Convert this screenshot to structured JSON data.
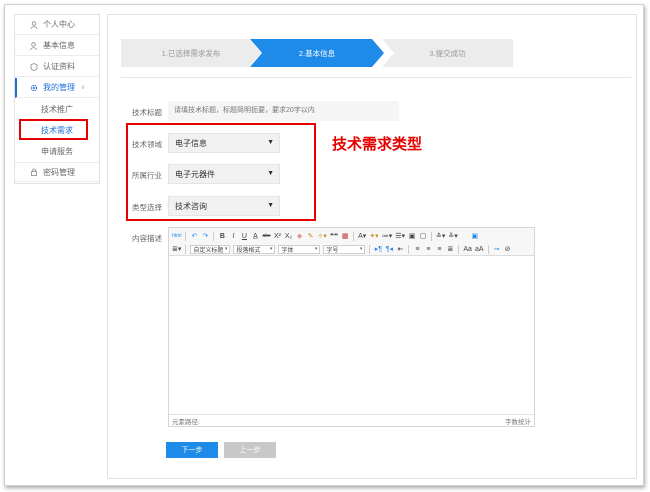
{
  "sidebar": {
    "items": [
      {
        "label": "个人中心",
        "icon": "user-icon"
      },
      {
        "label": "基本信息",
        "icon": "user-info-icon"
      },
      {
        "label": "认证资料",
        "icon": "shield-icon"
      },
      {
        "label": "我的管理",
        "icon": "gear-icon"
      },
      {
        "label": "技术推广"
      },
      {
        "label": "技术需求"
      },
      {
        "label": "申请服务"
      },
      {
        "label": "密码管理",
        "icon": "lock-icon"
      }
    ]
  },
  "steps": [
    {
      "label": "1.已选择需求发布",
      "state": "done"
    },
    {
      "label": "2.基本信息",
      "state": "active"
    },
    {
      "label": "3.提交成功",
      "state": "pending"
    }
  ],
  "form": {
    "title_label": "技术标题",
    "title_placeholder": "请填技术标题，标题简明扼要，要求20字以内",
    "field_label": "技术领域",
    "field_value": "电子信息",
    "industry_label": "所属行业",
    "industry_value": "电子元器件",
    "type_label": "类型选择",
    "type_value": "技术咨询",
    "content_label": "内容描述"
  },
  "annotation": "技术需求类型",
  "editor": {
    "custom_title": "自定义标题",
    "paragraph_format": "段落格式",
    "font": "字体",
    "font_size": "字号",
    "element_path": "元素路径:",
    "word_count": "字数统计"
  },
  "buttons": {
    "next": "下一步",
    "prev": "上一步"
  },
  "colors": {
    "primary": "#1f8be8",
    "highlight": "#e60000"
  }
}
